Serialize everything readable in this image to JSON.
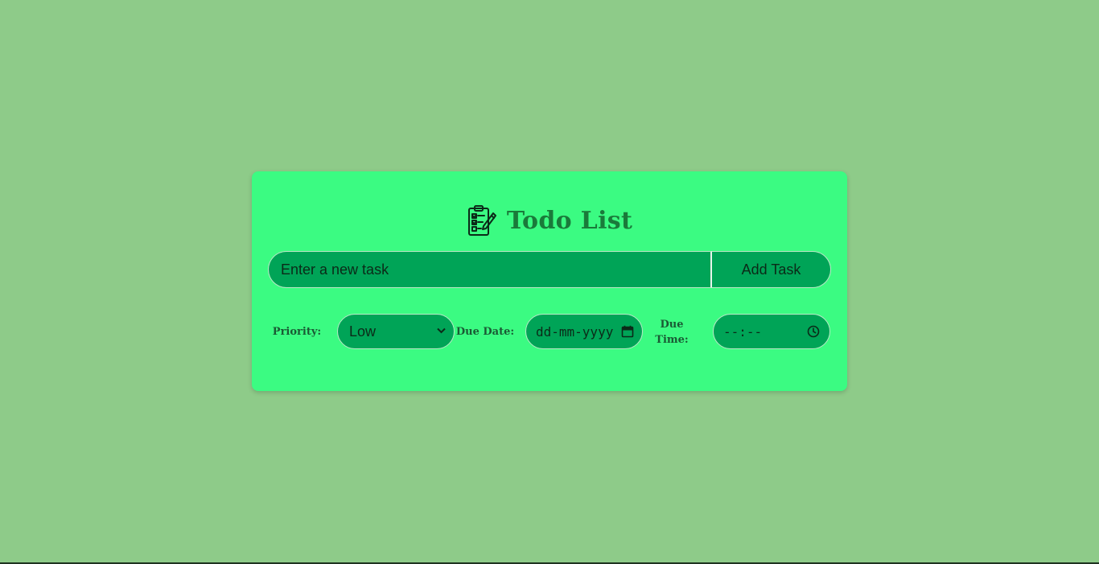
{
  "app": {
    "title": "Todo List",
    "icon": "clipboard-checklist-icon"
  },
  "task_entry": {
    "placeholder": "Enter a new task",
    "value": "",
    "add_label": "Add Task"
  },
  "options": {
    "priority_label": "Priority:",
    "priority_value": "Low",
    "due_date_label": "Due Date:",
    "due_date_placeholder": "dd-mm-yyyy",
    "due_time_label_1": "Due",
    "due_time_label_2": "Time:",
    "due_time_placeholder": "--:--"
  },
  "colors": {
    "background": "#8ecb89",
    "card": "#3bfb82",
    "field": "#00a457",
    "title": "#1a7a3a"
  },
  "icons": {
    "date": "calendar-icon",
    "time": "clock-icon",
    "dropdown": "chevron-down-icon"
  }
}
